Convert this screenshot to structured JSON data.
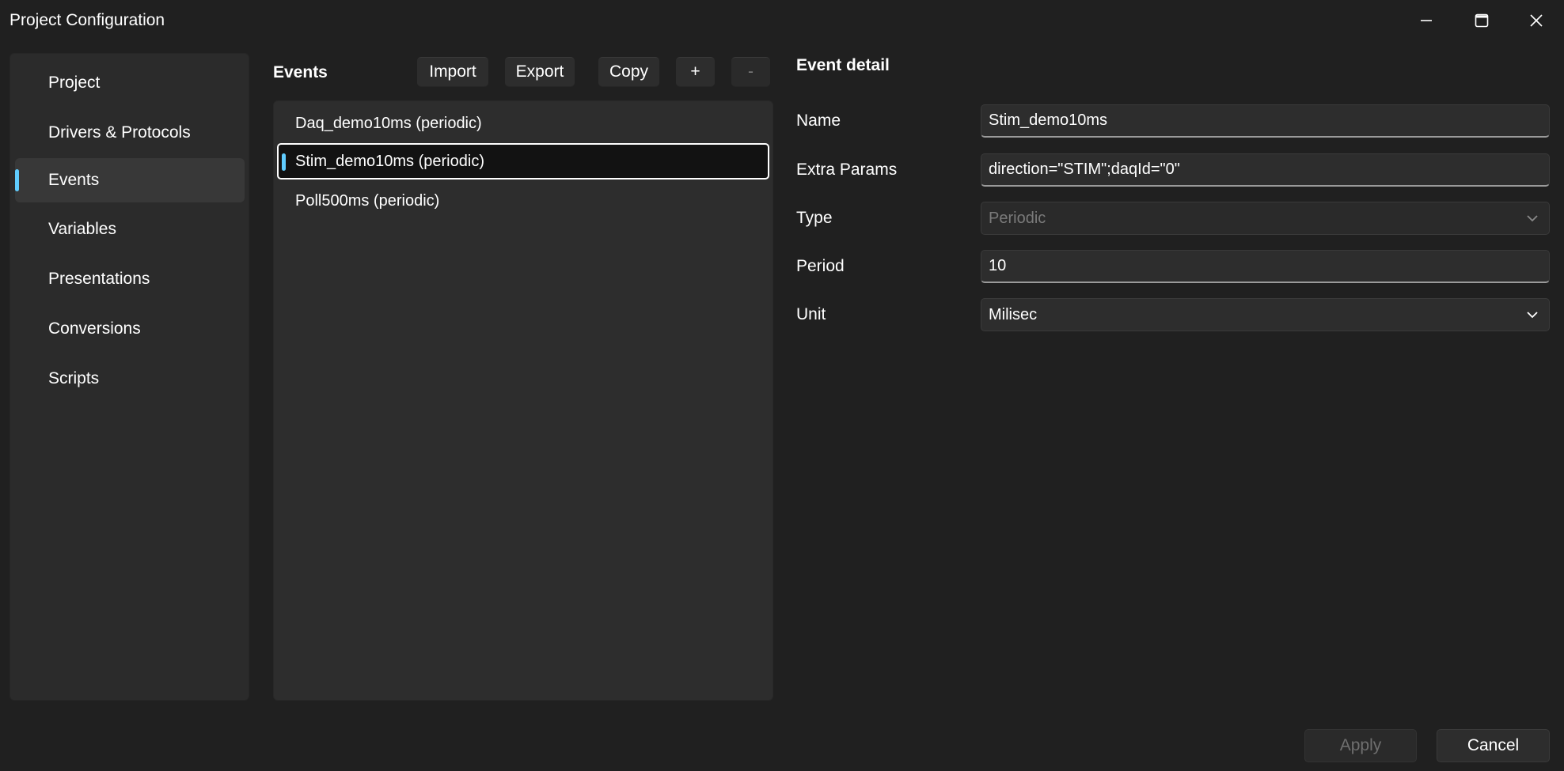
{
  "window": {
    "title": "Project Configuration",
    "controls": {
      "minimize_icon": "minimize-icon",
      "maximize_icon": "maximize-icon",
      "close_icon": "close-icon"
    }
  },
  "sidebar": {
    "items": [
      {
        "label": "Project",
        "selected": false
      },
      {
        "label": "Drivers & Protocols",
        "selected": false
      },
      {
        "label": "Events",
        "selected": true
      },
      {
        "label": "Variables",
        "selected": false
      },
      {
        "label": "Presentations",
        "selected": false
      },
      {
        "label": "Conversions",
        "selected": false
      },
      {
        "label": "Scripts",
        "selected": false
      }
    ]
  },
  "events": {
    "header": "Events",
    "toolbar": {
      "import_label": "Import",
      "export_label": "Export",
      "copy_label": "Copy",
      "add_label": "+",
      "remove_label": "-"
    },
    "items": [
      {
        "label": "Daq_demo10ms (periodic)",
        "selected": false
      },
      {
        "label": "Stim_demo10ms (periodic)",
        "selected": true
      },
      {
        "label": "Poll500ms (periodic)",
        "selected": false
      }
    ]
  },
  "detail": {
    "header": "Event detail",
    "name": {
      "label": "Name",
      "value": "Stim_demo10ms"
    },
    "extra_params": {
      "label": "Extra Params",
      "value": "direction=\"STIM\";daqId=\"0\""
    },
    "type": {
      "label": "Type",
      "value": "Periodic",
      "disabled": true
    },
    "period": {
      "label": "Period",
      "value": "10"
    },
    "unit": {
      "label": "Unit",
      "value": "Milisec"
    }
  },
  "footer": {
    "apply_label": "Apply",
    "cancel_label": "Cancel"
  },
  "colors": {
    "background": "#202020",
    "panel": "#2b2b2b",
    "accent": "#60cdff",
    "selected_item": "#121212"
  }
}
